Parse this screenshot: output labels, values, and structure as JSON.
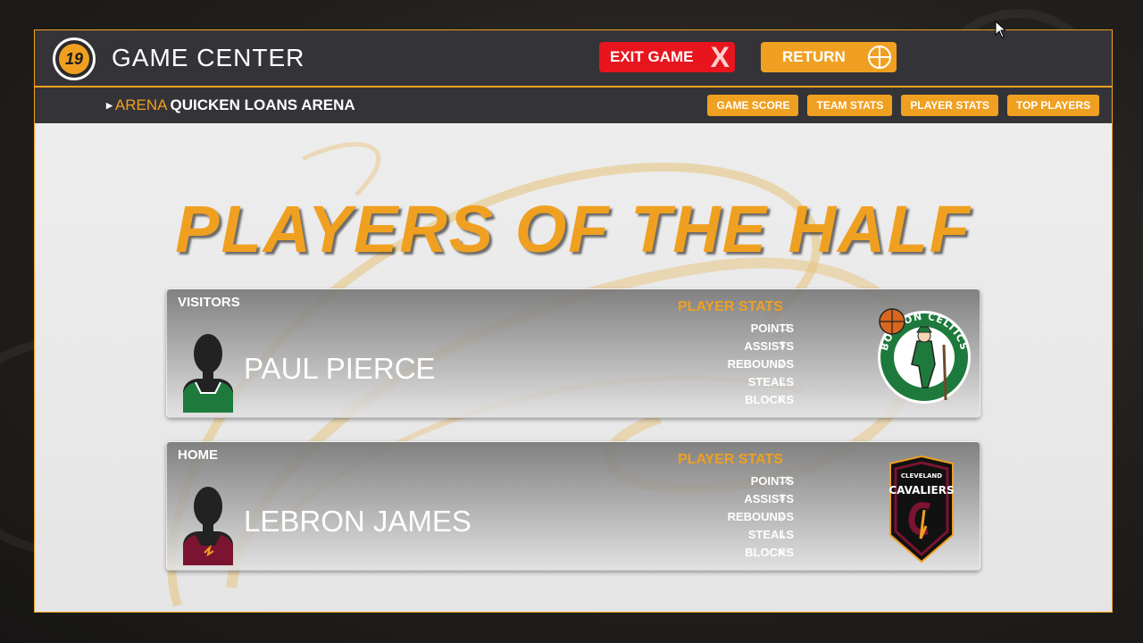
{
  "app": {
    "logo_text": "19",
    "title": "GAME CENTER"
  },
  "toolbar": {
    "exit_label": "EXIT GAME",
    "exit_icon": "X",
    "return_label": "RETURN"
  },
  "arena": {
    "label": "ARENA",
    "name": "QUICKEN LOANS ARENA"
  },
  "nav": {
    "tabs": [
      {
        "label": "GAME SCORE"
      },
      {
        "label": "TEAM STATS"
      },
      {
        "label": "PLAYER STATS"
      },
      {
        "label": "TOP PLAYERS"
      }
    ]
  },
  "headline": "PLAYERS OF THE HALF",
  "players": [
    {
      "side": "VISITORS",
      "name": "PAUL PIERCE",
      "stats_title": "PLAYER STATS",
      "stats": [
        {
          "label": "POINTS",
          "value": "11"
        },
        {
          "label": "ASSISTS",
          "value": "5"
        },
        {
          "label": "REBOUNDS",
          "value": "2"
        },
        {
          "label": "STEALS",
          "value": "2"
        },
        {
          "label": "BLOCKS",
          "value": "0"
        }
      ],
      "team_logo_text": "BOSTON CELTICS",
      "jersey_color": "#1e7a3c"
    },
    {
      "side": "HOME",
      "name": "LEBRON JAMES",
      "stats_title": "PLAYER STATS",
      "stats": [
        {
          "label": "POINTS",
          "value": "18"
        },
        {
          "label": "ASSISTS",
          "value": "8"
        },
        {
          "label": "REBOUNDS",
          "value": "2"
        },
        {
          "label": "STEALS",
          "value": "1"
        },
        {
          "label": "BLOCKS",
          "value": "0"
        }
      ],
      "team_logo_text_top": "CLEVELAND",
      "team_logo_text_main": "CAVALIERS",
      "jersey_color": "#7a1430"
    }
  ],
  "colors": {
    "accent": "#f0a020",
    "exit": "#e8141e",
    "bar": "#2a2a2e"
  },
  "icons": {
    "logo": "nba2k19-logo-icon",
    "exit": "close-icon",
    "return": "basketball-icon",
    "cursor": "mouse-cursor-icon"
  }
}
